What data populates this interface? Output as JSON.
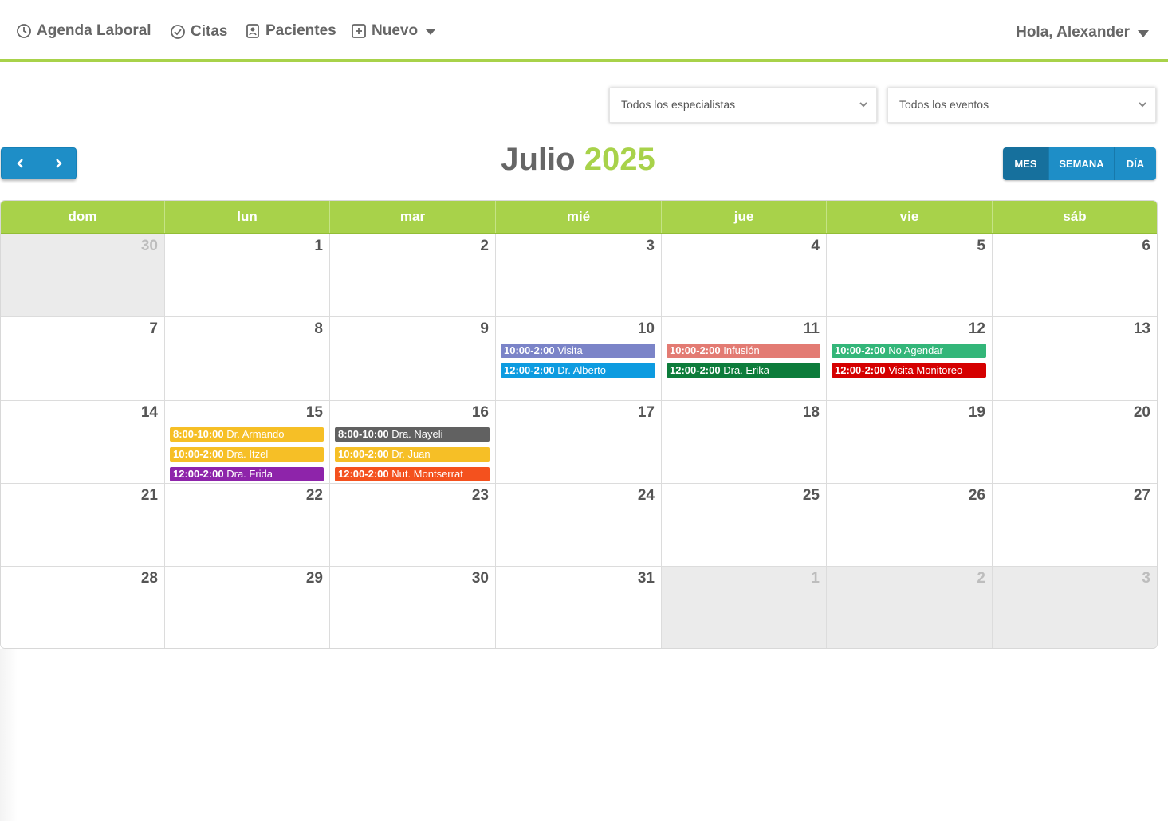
{
  "nav": {
    "agenda": "Agenda Laboral",
    "citas": "Citas",
    "pacientes": "Pacientes",
    "nuevo": "Nuevo",
    "user": "Hola, Alexander"
  },
  "filters": {
    "specialists": "Todos los especialistas",
    "events": "Todos los eventos"
  },
  "title": {
    "month": "Julio",
    "year": "2025"
  },
  "views": [
    "MES",
    "SEMANA",
    "DÍA"
  ],
  "active_view": "MES",
  "weekdays": [
    "dom",
    "lun",
    "mar",
    "mié",
    "jue",
    "vie",
    "sáb"
  ],
  "weeks": [
    [
      {
        "day": "30",
        "other": true,
        "events": []
      },
      {
        "day": "1",
        "events": []
      },
      {
        "day": "2",
        "events": []
      },
      {
        "day": "3",
        "events": []
      },
      {
        "day": "4",
        "events": []
      },
      {
        "day": "5",
        "events": []
      },
      {
        "day": "6",
        "events": []
      }
    ],
    [
      {
        "day": "7",
        "events": []
      },
      {
        "day": "8",
        "events": []
      },
      {
        "day": "9",
        "events": []
      },
      {
        "day": "10",
        "events": [
          {
            "time": "10:00-2:00",
            "title": "Visita",
            "color": "#7b84c8"
          },
          {
            "time": "12:00-2:00",
            "title": "Dr. Alberto",
            "color": "#0d9be0"
          }
        ]
      },
      {
        "day": "11",
        "events": [
          {
            "time": "10:00-2:00",
            "title": "Infusión",
            "color": "#e37b73"
          },
          {
            "time": "12:00-2:00",
            "title": "Dra. Erika",
            "color": "#0d7c3b"
          }
        ]
      },
      {
        "day": "12",
        "events": [
          {
            "time": "10:00-2:00",
            "title": "No Agendar",
            "color": "#33b679"
          },
          {
            "time": "12:00-2:00",
            "title": "Visita Monitoreo",
            "color": "#d50000"
          }
        ]
      },
      {
        "day": "13",
        "events": []
      }
    ],
    [
      {
        "day": "14",
        "events": []
      },
      {
        "day": "15",
        "events": [
          {
            "time": "8:00-10:00",
            "title": "Dr. Armando",
            "color": "#f6bf26"
          },
          {
            "time": "10:00-2:00",
            "title": "Dra. Itzel",
            "color": "#f6bf26"
          },
          {
            "time": "12:00-2:00",
            "title": "Dra. Frida",
            "color": "#8e24aa"
          }
        ]
      },
      {
        "day": "16",
        "events": [
          {
            "time": "8:00-10:00",
            "title": "Dra. Nayeli",
            "color": "#616161"
          },
          {
            "time": "10:00-2:00",
            "title": "Dr. Juan",
            "color": "#f6bf26"
          },
          {
            "time": "12:00-2:00",
            "title": "Nut. Montserrat",
            "color": "#f4511e"
          }
        ]
      },
      {
        "day": "17",
        "events": []
      },
      {
        "day": "18",
        "events": []
      },
      {
        "day": "19",
        "events": []
      },
      {
        "day": "20",
        "events": []
      }
    ],
    [
      {
        "day": "21",
        "events": []
      },
      {
        "day": "22",
        "events": []
      },
      {
        "day": "23",
        "events": []
      },
      {
        "day": "24",
        "events": []
      },
      {
        "day": "25",
        "events": []
      },
      {
        "day": "26",
        "events": []
      },
      {
        "day": "27",
        "events": []
      }
    ],
    [
      {
        "day": "28",
        "events": []
      },
      {
        "day": "29",
        "events": []
      },
      {
        "day": "30",
        "events": []
      },
      {
        "day": "31",
        "events": []
      },
      {
        "day": "1",
        "other": true,
        "events": []
      },
      {
        "day": "2",
        "other": true,
        "events": []
      },
      {
        "day": "3",
        "other": true,
        "events": []
      }
    ]
  ],
  "colors": {
    "accent": "#a8d24a",
    "primary": "#1e8ec7",
    "primary_dark": "#16709d"
  }
}
